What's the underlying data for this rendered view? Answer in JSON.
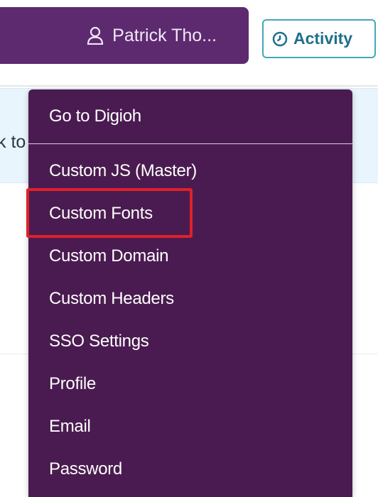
{
  "header": {
    "user_button_label": "Patrick Tho...",
    "activity_label": "Activity"
  },
  "background": {
    "info_strip_text": "k to"
  },
  "menu": {
    "items": [
      {
        "label": "Go to Digioh"
      },
      {
        "label": "Custom JS (Master)"
      },
      {
        "label": "Custom Fonts",
        "highlighted": true
      },
      {
        "label": "Custom Domain"
      },
      {
        "label": "Custom Headers"
      },
      {
        "label": "SSO Settings"
      },
      {
        "label": "Profile"
      },
      {
        "label": "Email"
      },
      {
        "label": "Password"
      }
    ]
  },
  "colors": {
    "menu_bg": "#4a1b50",
    "user_button_bg": "#5d2a70",
    "activity_border": "#41a8bb",
    "highlight": "#e0212a"
  },
  "icons": {
    "user": "user-icon",
    "activity": "clock-icon"
  }
}
